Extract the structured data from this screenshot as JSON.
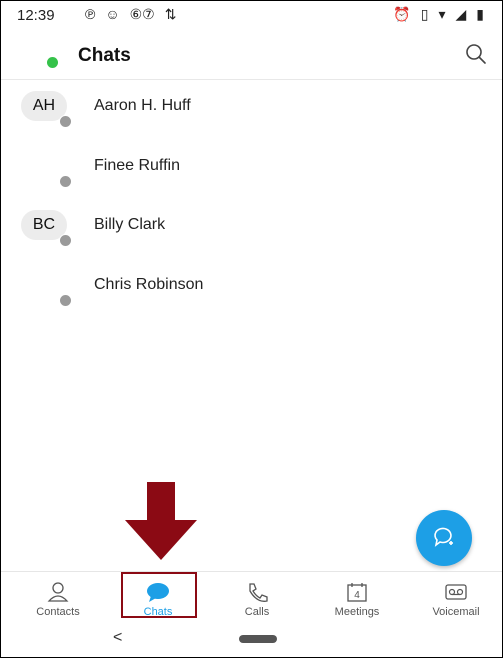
{
  "status_bar": {
    "time": "12:39",
    "left_icons": [
      "pinterest-icon",
      "voicemail-badge-icon",
      "notification-count-icon",
      "network-activity-icon"
    ],
    "right_icons": [
      "alarm-icon",
      "vibrate-icon",
      "wifi-icon",
      "signal-icon",
      "battery-icon"
    ],
    "left_glyphs": [
      "℗",
      "☺",
      "⑥⑦",
      "⇅"
    ],
    "right_glyphs": [
      "⏰",
      "▯",
      "▾",
      "◢",
      "▮"
    ]
  },
  "header": {
    "title": "Chats",
    "presence_color": "#35c24a",
    "search_icon": "search-icon"
  },
  "chats": [
    {
      "initials": "AH",
      "name": "Aaron H. Huff"
    },
    {
      "initials": "",
      "name": "Finee Ruffin"
    },
    {
      "initials": "BC",
      "name": "Billy Clark"
    },
    {
      "initials": "",
      "name": "Chris Robinson"
    }
  ],
  "fab": {
    "icon": "new-chat-icon",
    "color": "#1d9fe6"
  },
  "tabs": [
    {
      "label": "Contacts",
      "icon": "contacts-icon",
      "active": false
    },
    {
      "label": "Chats",
      "icon": "chats-icon",
      "active": true
    },
    {
      "label": "Calls",
      "icon": "phone-icon",
      "active": false
    },
    {
      "label": "Meetings",
      "icon": "calendar-icon",
      "active": false,
      "badge": "4"
    },
    {
      "label": "Voicemail",
      "icon": "voicemail-icon",
      "active": false
    }
  ],
  "annotation": {
    "arrow_color": "#8b0a14",
    "highlight": "Chats"
  },
  "nav": {
    "back_glyph": "<"
  }
}
